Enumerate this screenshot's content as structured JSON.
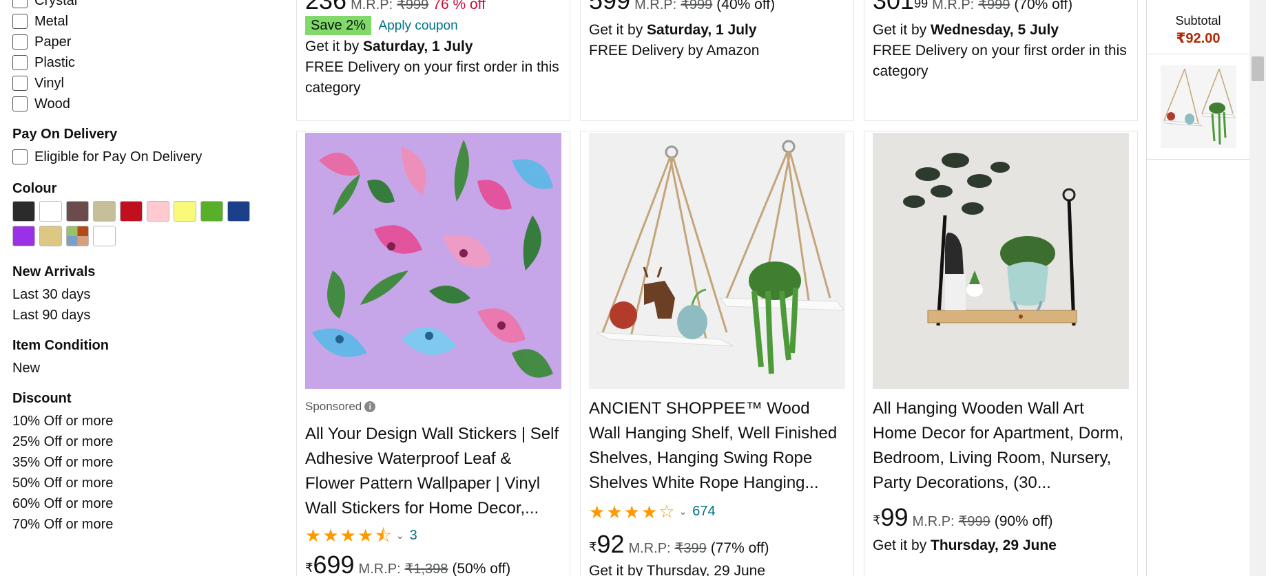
{
  "sidebar": {
    "materials": [
      "Crystal",
      "Metal",
      "Paper",
      "Plastic",
      "Vinyl",
      "Wood"
    ],
    "pay_on_delivery": {
      "title": "Pay On Delivery",
      "option": "Eligible for Pay On Delivery"
    },
    "colour": {
      "title": "Colour",
      "swatches": [
        "#2b2b2b",
        "#ffffff",
        "#6b4b4b",
        "#c7bf9a",
        "#c00f1d",
        "#ffc9d0",
        "#fafa7a",
        "#58b028",
        "#1c3f8a",
        "#9b31e6",
        "#dcc884",
        "multi",
        "#ffffff"
      ]
    },
    "new_arrivals": {
      "title": "New Arrivals",
      "items": [
        "Last 30 days",
        "Last 90 days"
      ]
    },
    "item_condition": {
      "title": "Item Condition",
      "items": [
        "New"
      ]
    },
    "discount": {
      "title": "Discount",
      "items": [
        "10% Off or more",
        "25% Off or more",
        "35% Off or more",
        "50% Off or more",
        "60% Off or more",
        "70% Off or more"
      ]
    },
    "partial_bottom": "..."
  },
  "top_row": [
    {
      "price": "236",
      "mrp_label": "M.R.P:",
      "mrp": "₹999",
      "off": "76 % off",
      "save_badge": "Save 2%",
      "coupon": "Apply coupon",
      "delivery_prefix": "Get it by ",
      "delivery_date": "Saturday, 1 July",
      "free_delivery": "FREE Delivery on your first order in this category"
    },
    {
      "price": "599",
      "mrp_label": "M.R.P:",
      "mrp": "₹999",
      "off": "(40% off)",
      "delivery_prefix": "Get it by ",
      "delivery_date": "Saturday, 1 July",
      "free_delivery": "FREE Delivery by Amazon"
    },
    {
      "price": "301",
      "price_sup": "99",
      "mrp_label": "M.R.P:",
      "mrp": "₹999",
      "off": "(70% off)",
      "delivery_prefix": "Get it by ",
      "delivery_date": "Wednesday, 5 July",
      "free_delivery": "FREE Delivery on your first order in this category"
    }
  ],
  "products": [
    {
      "sponsored": "Sponsored",
      "title": "All Your Design Wall Stickers | Self Adhesive Waterproof Leaf & Flower Pattern Wallpaper | Vinyl Wall Stickers for Home Decor,...",
      "rating_count": "3",
      "currency": "₹",
      "price": "699",
      "mrp_label": "M.R.P:",
      "mrp": "₹1,398",
      "off": "(50% off)"
    },
    {
      "title": "ANCIENT SHOPPEE™ Wood Wall Hanging Shelf, Well Finished Shelves, Hanging Swing Rope Shelves White Rope Hanging...",
      "rating_count": "674",
      "currency": "₹",
      "price": "92",
      "mrp_label": "M.R.P:",
      "mrp": "₹399",
      "off": "(77% off)",
      "delivery_partial": "Get it by Thursday, 29 June"
    },
    {
      "title": "All Hanging Wooden Wall Art Home Decor for Apartment, Dorm, Bedroom, Living Room, Nursery, Party Decorations, (30...",
      "currency": "₹",
      "price": "99",
      "mrp_label": "M.R.P:",
      "mrp": "₹999",
      "off": "(90% off)",
      "delivery_prefix": "Get it by ",
      "delivery_date": "Thursday, 29 June"
    }
  ],
  "cart": {
    "subtotal_label": "Subtotal",
    "subtotal": "₹92.00"
  }
}
